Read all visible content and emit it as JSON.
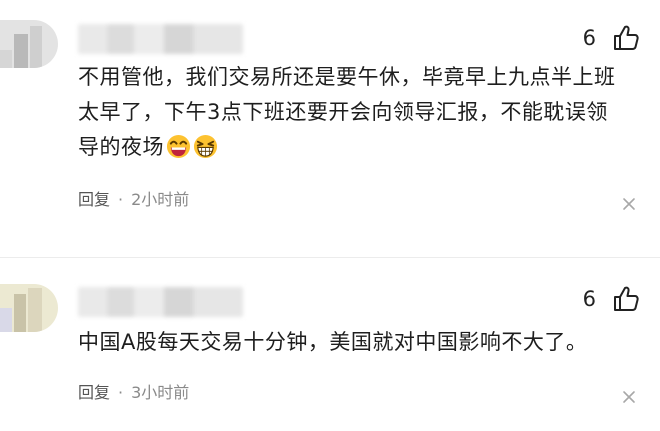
{
  "comments": [
    {
      "like_count": "6",
      "lines": [
        "不用管他，我们交易所还是要午休，毕竟早上九点半上班",
        "太早了，下午3点下班还要开会向领导汇报，不能耽误领",
        "导的夜场"
      ],
      "emojis": [
        "grin-sweat-emoji-icon",
        "beaming-emoji-icon"
      ],
      "reply_label": "回复",
      "separator": "·",
      "time": "2小时前"
    },
    {
      "like_count": "6",
      "lines": [
        "中国A股每天交易十分钟，美国就对中国影响不大了。"
      ],
      "reply_label": "回复",
      "separator": "·",
      "time": "3小时前"
    }
  ],
  "colors": {
    "accent_emoji": "#f7b500",
    "text": "#1e1e1e",
    "meta": "#8a8a8a"
  }
}
